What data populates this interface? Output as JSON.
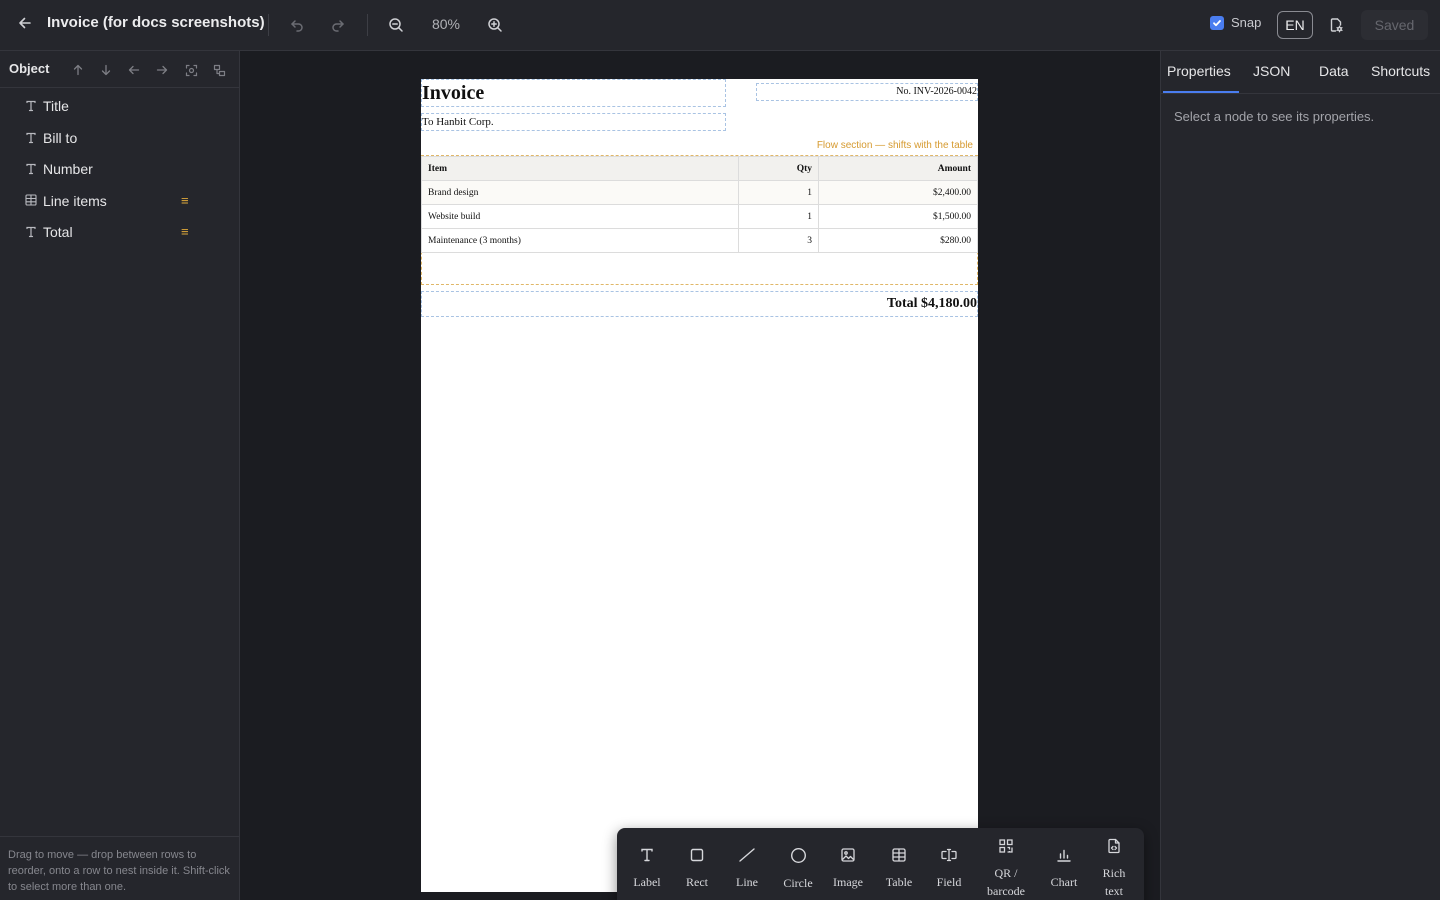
{
  "header": {
    "title": "Invoice (for docs screenshots)",
    "zoom": "80%",
    "snap_label": "Snap",
    "snap_checked": true,
    "lang": "EN",
    "saved_label": "Saved"
  },
  "left_panel": {
    "title": "Object",
    "items": [
      {
        "label": "Title",
        "icon": "text-icon",
        "flow": ""
      },
      {
        "label": "Bill to",
        "icon": "text-icon",
        "flow": ""
      },
      {
        "label": "Number",
        "icon": "text-icon",
        "flow": ""
      },
      {
        "label": "Line items",
        "icon": "table-icon",
        "flow": "≡"
      },
      {
        "label": "Total",
        "icon": "text-icon",
        "flow": "≡"
      }
    ],
    "hint": "Drag to move — drop between rows to reorder, onto a row to nest inside it. Shift-click to select more than one."
  },
  "page": {
    "title": "Invoice",
    "bill_to": "To Hanbit Corp.",
    "number": "No. INV-2026-0042",
    "flow_note": "Flow section — shifts with the table",
    "table": {
      "headers": [
        "Item",
        "Qty",
        "Amount"
      ],
      "rows": [
        [
          "Brand design",
          "1",
          "$2,400.00"
        ],
        [
          "Website build",
          "1",
          "$1,500.00"
        ],
        [
          "Maintenance (3 months)",
          "3",
          "$280.00"
        ]
      ]
    },
    "total": "Total $4,180.00"
  },
  "insert_toolbar": {
    "items": [
      "Label",
      "Rect",
      "Line",
      "Circle",
      "Image",
      "Table",
      "Field",
      "QR /\nbarcode",
      "Chart",
      "Rich\ntext"
    ]
  },
  "right_panel": {
    "tabs": [
      "Properties",
      "JSON",
      "Data",
      "Shortcuts"
    ],
    "active_tab": "Properties",
    "empty_message": "Select a node to see its properties."
  },
  "colors": {
    "accent": "#4a7df0",
    "flow": "#e0a93a",
    "node_outline": "#a9c3e3"
  }
}
